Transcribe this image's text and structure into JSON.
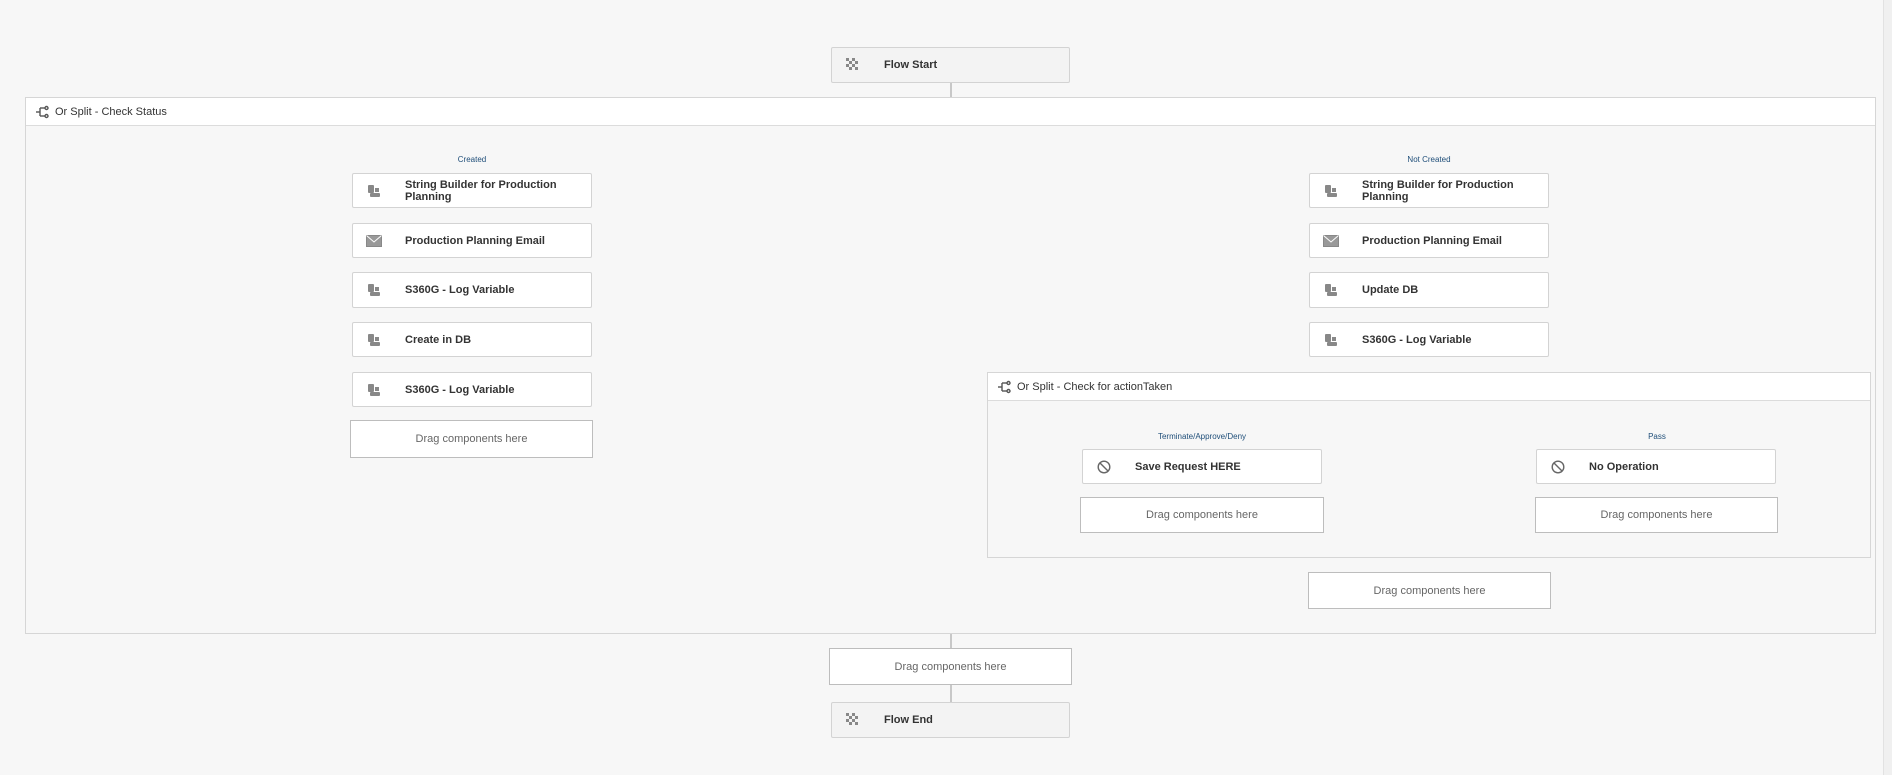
{
  "flow": {
    "start_label": "Flow Start",
    "end_label": "Flow End"
  },
  "outer_split": {
    "title": "Or Split - Check Status",
    "branch_left": "Created",
    "branch_right": "Not Created"
  },
  "left_branch": {
    "steps": [
      {
        "label": "String Builder for Production Planning",
        "icon": "service-icon"
      },
      {
        "label": "Production Planning Email",
        "icon": "envelope-icon"
      },
      {
        "label": "S360G - Log Variable",
        "icon": "service-icon"
      },
      {
        "label": "Create in DB",
        "icon": "service-icon"
      },
      {
        "label": "S360G - Log Variable",
        "icon": "service-icon"
      }
    ],
    "drop_label": "Drag components here"
  },
  "right_branch": {
    "steps": [
      {
        "label": "String Builder for Production Planning",
        "icon": "service-icon"
      },
      {
        "label": "Production Planning Email",
        "icon": "envelope-icon"
      },
      {
        "label": "Update DB",
        "icon": "service-icon"
      },
      {
        "label": "S360G - Log Variable",
        "icon": "service-icon"
      }
    ],
    "drop_label": "Drag components here"
  },
  "inner_split": {
    "title": "Or Split - Check for actionTaken",
    "branch_left": "Terminate/Approve/Deny",
    "branch_right": "Pass",
    "left_step": "Save Request HERE",
    "right_step": "No Operation",
    "left_drop": "Drag components here",
    "right_drop": "Drag components here"
  },
  "after_split_drop": "Drag components here",
  "colors": {
    "background": "#f7f7f7",
    "node_border": "#d3d3d3",
    "branch_label": "#1f4e79",
    "connector": "#9a9a9a"
  }
}
